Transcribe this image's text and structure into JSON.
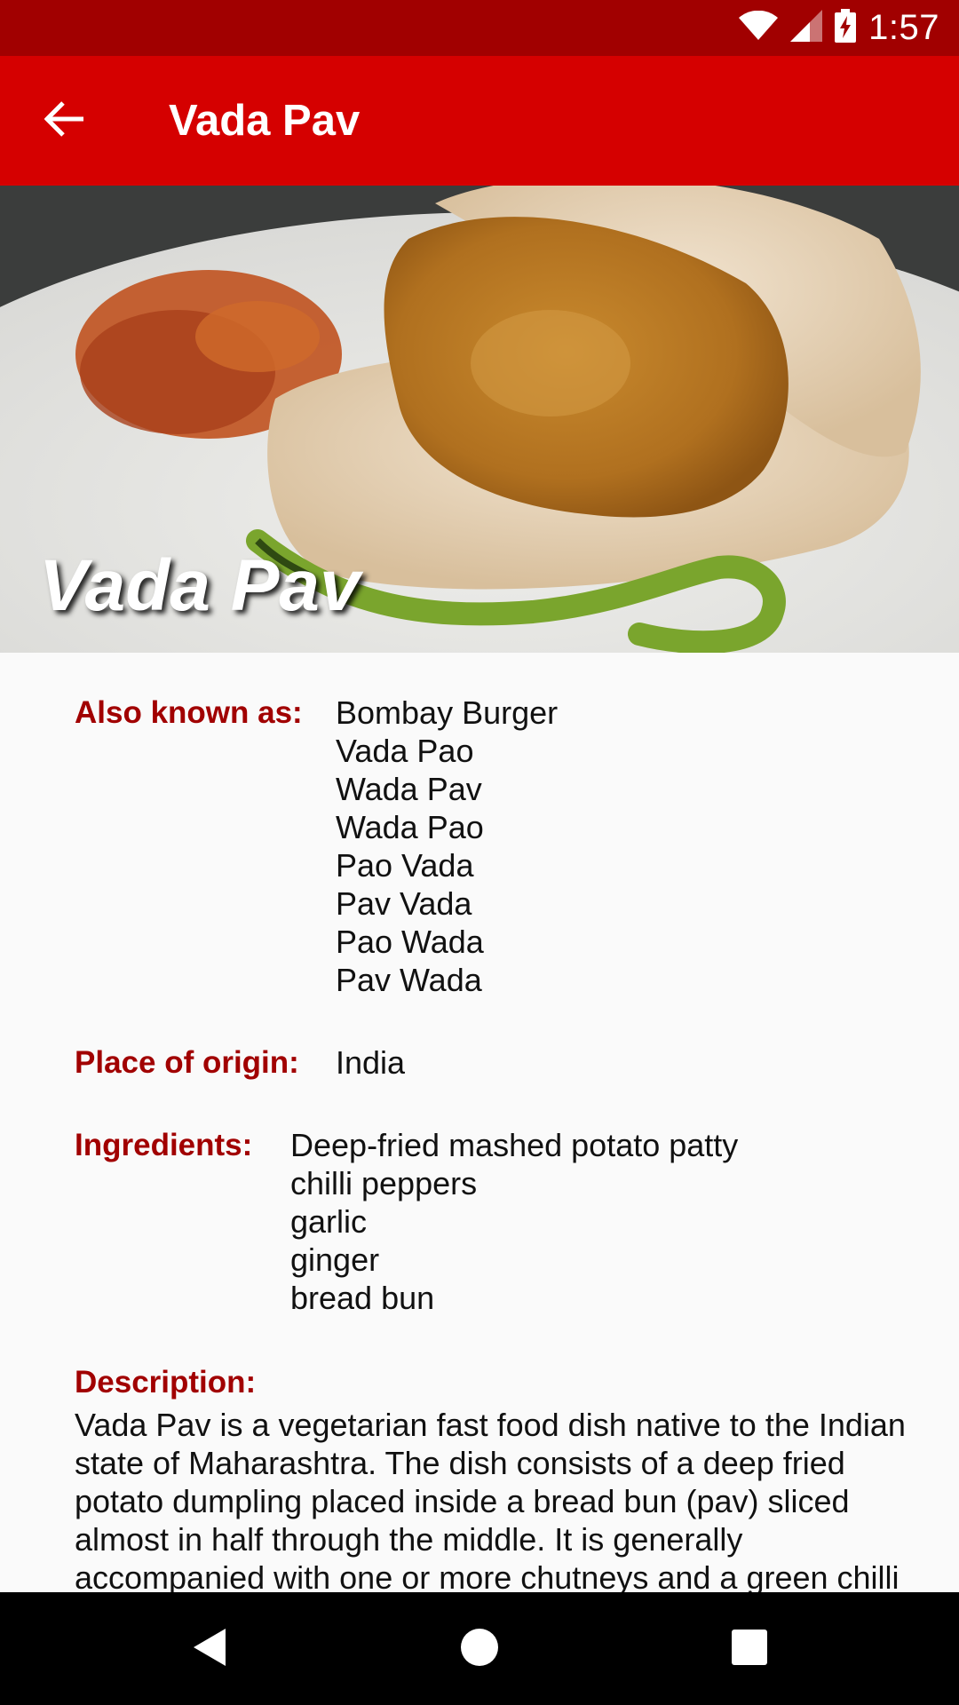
{
  "status_bar": {
    "time": "1:57",
    "icons": [
      "wifi-icon",
      "signal-icon",
      "battery-charging-icon"
    ]
  },
  "app_bar": {
    "title": "Vada Pav",
    "back_icon": "arrow-back-icon"
  },
  "hero": {
    "title": "Vada Pav"
  },
  "details": {
    "also_known_as": {
      "label": "Also known as:",
      "values": [
        "Bombay Burger",
        "Vada Pao",
        "Wada Pav",
        "Wada Pao",
        "Pao Vada",
        "Pav Vada",
        "Pao Wada",
        "Pav Wada"
      ]
    },
    "place_of_origin": {
      "label": "Place of origin:",
      "value": "India"
    },
    "ingredients": {
      "label": "Ingredients:",
      "values": [
        "Deep-fried mashed potato patty",
        "chilli peppers",
        "garlic",
        "ginger",
        "bread bun"
      ]
    },
    "description": {
      "label": "Description:",
      "text": "Vada Pav is a vegetarian fast food dish native to the Indian state of Maharashtra. The dish consists of a deep fried potato dumpling placed inside a bread bun (pav) sliced almost in half through the middle. It is generally accompanied with one or more chutneys and a green chilli"
    }
  },
  "nav_bar": {
    "back": "nav-back-icon",
    "home": "nav-home-icon",
    "recents": "nav-recents-icon"
  },
  "colors": {
    "status_bar": "#a10000",
    "app_bar": "#d50000",
    "label": "#a10000",
    "background": "#fafafa"
  }
}
